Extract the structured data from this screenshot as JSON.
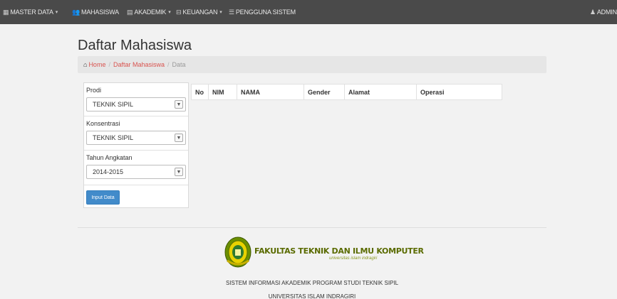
{
  "navbar": {
    "items": [
      {
        "icon": "table-icon",
        "label": "MASTER DATA",
        "has_caret": true
      },
      {
        "icon": "users-icon",
        "label": "MAHASISWA",
        "has_caret": false
      },
      {
        "icon": "book-icon",
        "label": "AKADEMIK",
        "has_caret": true
      },
      {
        "icon": "money-icon",
        "label": "KEUANGAN",
        "has_caret": true
      },
      {
        "icon": "list-icon",
        "label": "PENGGUNA SISTEM",
        "has_caret": false
      }
    ],
    "user": {
      "icon": "user-icon",
      "label": "ADMIN"
    }
  },
  "page": {
    "title": "Daftar Mahasiswa"
  },
  "breadcrumb": {
    "home": "Home",
    "section": "Daftar Mahasiswa",
    "current": "Data",
    "separator": "/"
  },
  "filters": {
    "prodi": {
      "label": "Prodi",
      "value": "TEKNIK SIPIL"
    },
    "konsentrasi": {
      "label": "Konsentrasi",
      "value": "TEKNIK SIPIL"
    },
    "tahun": {
      "label": "Tahun Angkatan",
      "value": "2014-2015"
    },
    "input_button": "Input Data"
  },
  "table": {
    "columns": [
      "No",
      "NIM",
      "NAMA",
      "Gender",
      "Alamat",
      "Operasi"
    ]
  },
  "footer": {
    "logo_text": "FAKULTAS TEKNIK DAN ILMU KOMPUTER",
    "logo_sub": "universitas islam indragiri",
    "line1": "SISTEM INFORMASI AKADEMIK PROGRAM STUDI TEKNIK SIPIL",
    "line2": "UNIVERSITAS ISLAM INDRAGIRI"
  },
  "colors": {
    "navbar": "#4a4a4a",
    "accent_link": "#d9534f",
    "primary_button": "#428bca",
    "logo_green": "#5a6b00"
  }
}
